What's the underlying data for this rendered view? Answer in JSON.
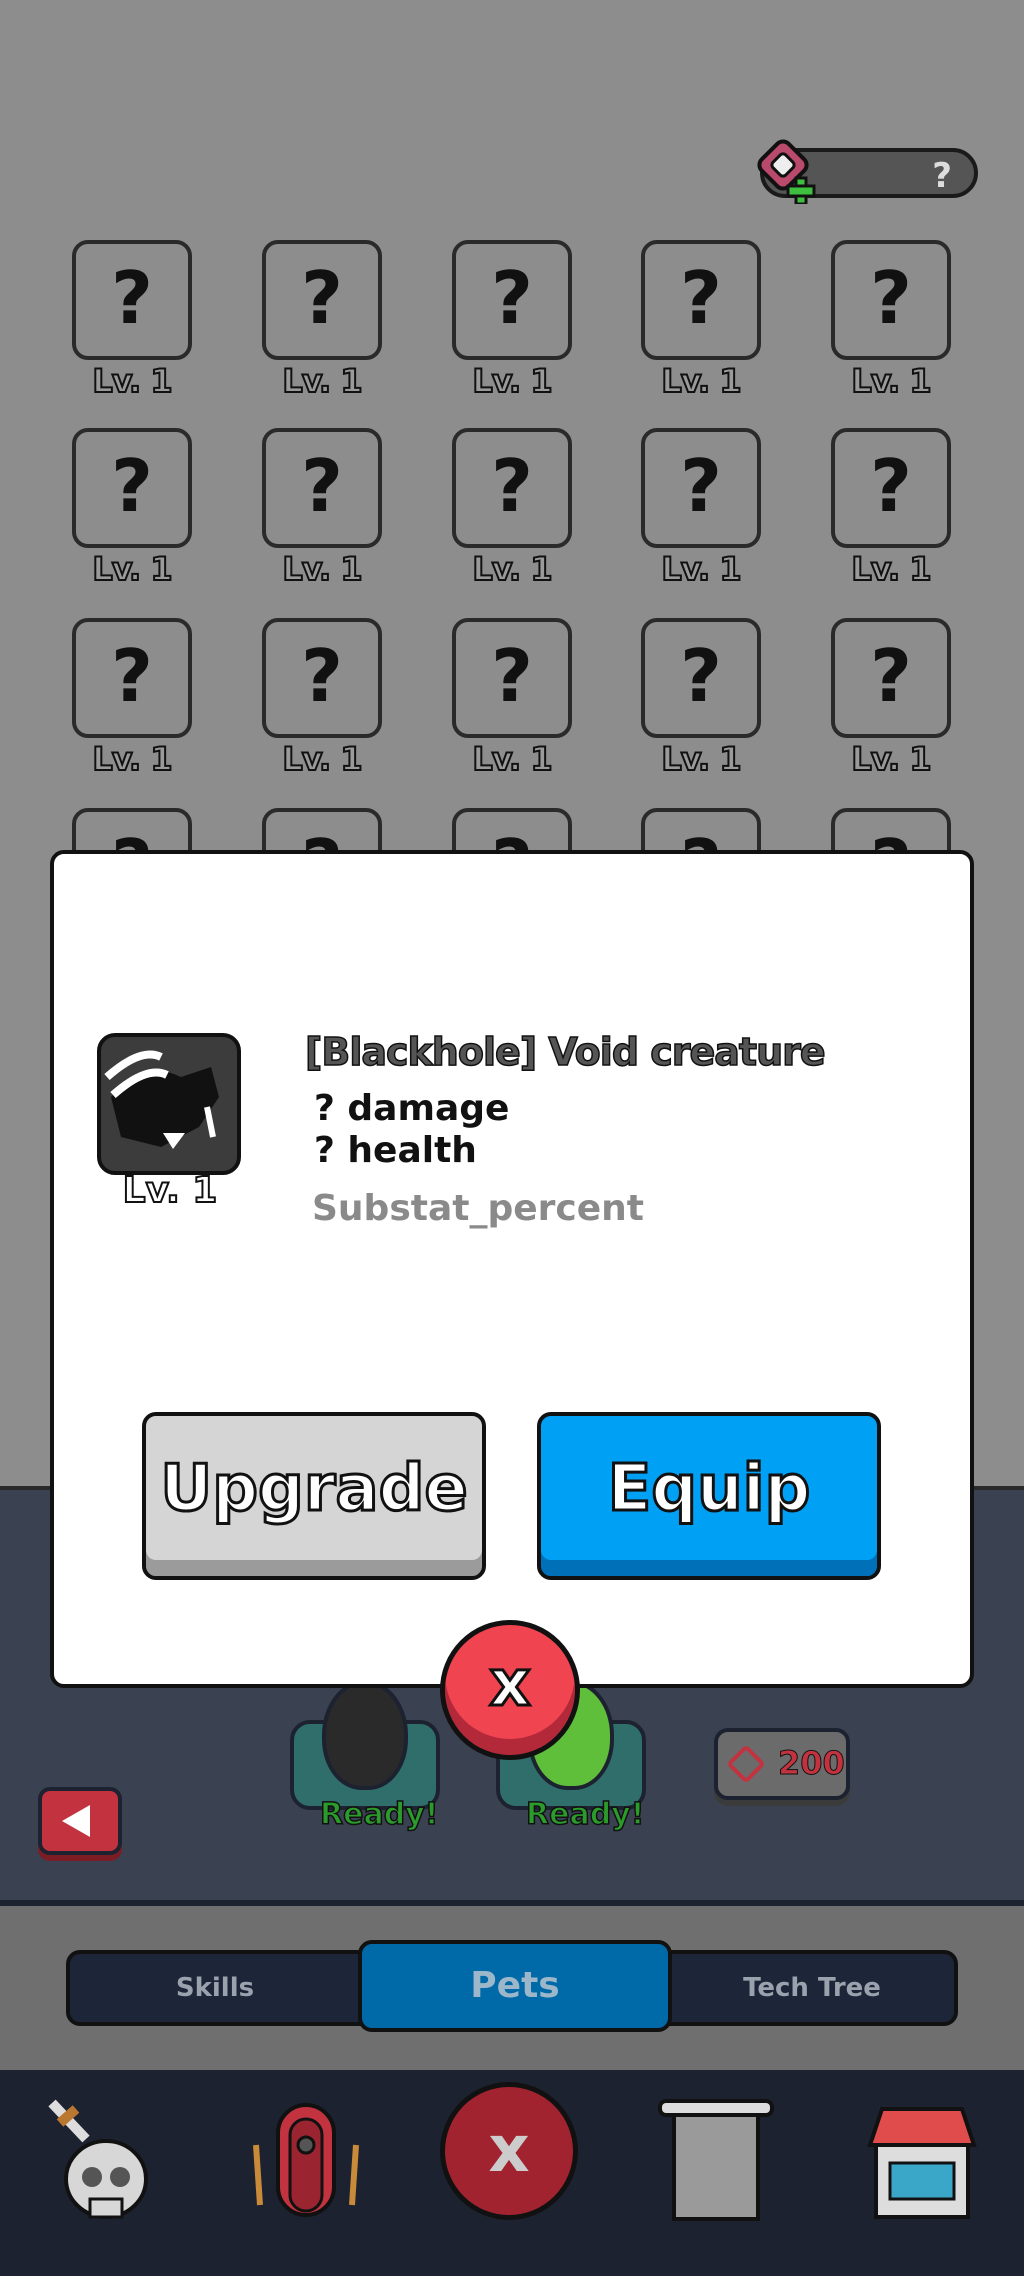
{
  "currency": {
    "value": "?"
  },
  "grid": {
    "question_mark": "?",
    "level_label": "Lv. 1"
  },
  "modal": {
    "title": "[Blackhole] Void creature",
    "level": "Lv. 1",
    "stats": [
      "? damage",
      "? health"
    ],
    "substat": "Substat_percent",
    "upgrade_label": "Upgrade",
    "equip_label": "Equip",
    "close_label": "x"
  },
  "eggs": [
    {
      "status": "Ready!",
      "color": "#2a2a2a"
    },
    {
      "status": "Ready!",
      "color": "#5fbf3a"
    }
  ],
  "cost_button": {
    "value": "200"
  },
  "tabs": [
    {
      "label": "Skills"
    },
    {
      "label": "Pets",
      "active": true
    },
    {
      "label": "Tech Tree"
    }
  ],
  "nav": {
    "icons": [
      "skull-icon",
      "door-icon",
      "close-icon",
      "banner-icon",
      "shop-icon"
    ],
    "close_label": "x"
  },
  "colors": {
    "equip": "#00a0f5",
    "upgrade": "#d5d5d5",
    "close": "#f04450",
    "tab_active": "#0069a8"
  }
}
